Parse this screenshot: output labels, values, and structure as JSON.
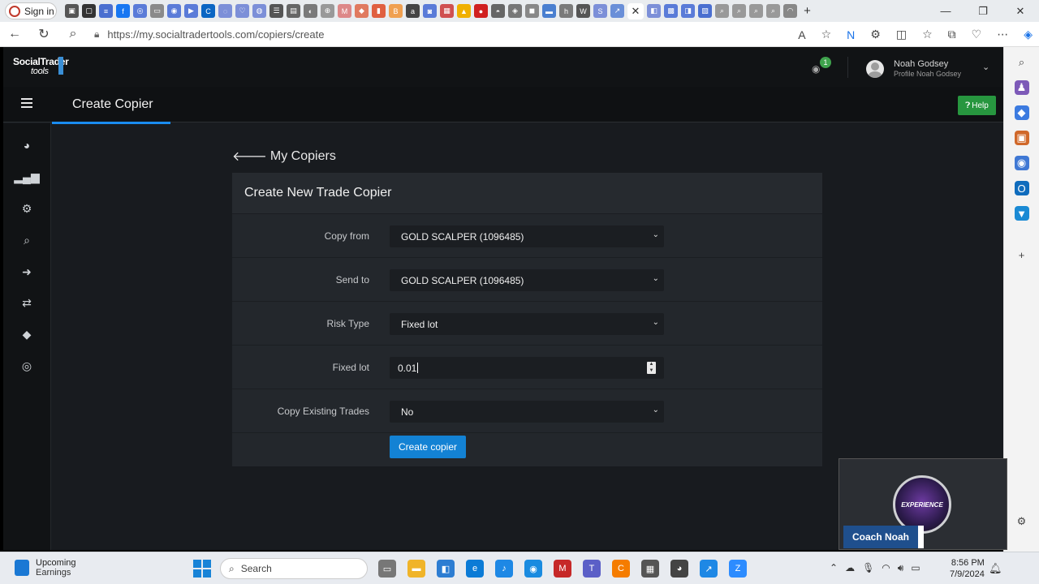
{
  "browser": {
    "signin_label": "Sign in",
    "url": "https://my.socialtradertools.com/copiers/create",
    "active_tab_close": "✕"
  },
  "app": {
    "logo_line1": "SocialTrader",
    "logo_line2": "tools",
    "notification_count": "1",
    "user_name": "Noah Godsey",
    "user_profile": "Profile Noah Godsey",
    "page_title": "Create Copier",
    "help_label": "Help",
    "back_label": "My Copiers",
    "card_title": "Create New Trade Copier",
    "form": [
      {
        "label": "Copy from",
        "value": "GOLD SCALPER (1096485)",
        "kind": "select"
      },
      {
        "label": "Send to",
        "value": "GOLD SCALPER (1096485)",
        "kind": "select"
      },
      {
        "label": "Risk Type",
        "value": "Fixed lot",
        "kind": "select"
      },
      {
        "label": "Fixed lot",
        "value": "0.01",
        "kind": "number"
      },
      {
        "label": "Copy Existing Trades",
        "value": "No",
        "kind": "select"
      }
    ],
    "submit_label": "Create copier"
  },
  "webcam": {
    "name": "Coach Noah",
    "logo_text": "EXPERIENCE"
  },
  "taskbar": {
    "weather_title": "Upcoming",
    "weather_sub": "Earnings",
    "search_placeholder": "Search",
    "time": "8:56 PM",
    "date": "7/9/2024"
  },
  "colors": {
    "accent_blue": "#1382d4",
    "help_green": "#27963f",
    "app_bg": "#181b1f",
    "card_bg": "#23272c"
  }
}
